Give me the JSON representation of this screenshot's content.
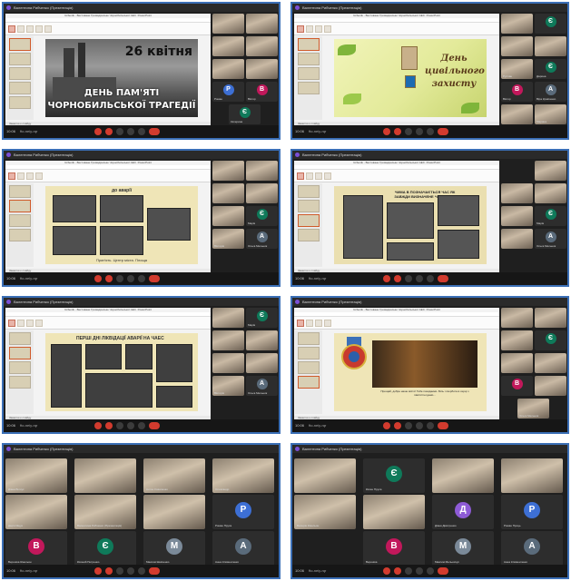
{
  "meet": {
    "presenter": "Валентина Рибченко (Презентація)",
    "time": "10:06",
    "meeting_code": "fto-neiy-rqr",
    "colors": {
      "frame": "#3b6fb6",
      "end_call": "#d23b2e"
    }
  },
  "ppt": {
    "window_title": "Ucbenik - Вестоване Громадянське Чорнобильської АЕС. PowerPoint",
    "status": "Заметки к слайду"
  },
  "slides": {
    "s1": {
      "date": "26 квітня",
      "line1": "ДЕНЬ ПАМ'ЯТІ",
      "line2": "ЧОРНОБИЛЬСЬКОЇ ТРАГЕДІЇ"
    },
    "s2": {
      "line1": "День",
      "line2": "цивільного",
      "line3": "захисту"
    },
    "s3": {
      "header": "до аварії",
      "label": "Прип'ять. Центр міста. Площа"
    },
    "s4": {
      "question": "ЧИМА В ПОЗНАЧАЄТЬСЯ ЧАС ЯК ЗАВЖДИ ВИЗНАЧЕНЕ ЧАС РОКУ?"
    },
    "s5": {
      "header": "ПЕРШІ ДНІ ЛІКВІДАЦІЇ АВАРІЇ НА ЧАЕС"
    },
    "s6": {
      "poem": "Прощай, добре наше місто! Тебе покидаємо. Біль і скорбота в серці з пам'яттю ідемо..."
    }
  },
  "participants": {
    "p1": [
      "Наталія",
      "Степан",
      "Володимир",
      "Сергій",
      "Роман",
      "Віктор",
      "Вікторія",
      "Катерина",
      "Ольга Мельник"
    ],
    "p2": [
      "Валентина",
      "Марія",
      "Руслан",
      "Сергій",
      "Дарина",
      "Віктор",
      "Богдан",
      "Віра Кравченко",
      "Марина"
    ],
    "gallery": [
      "Діана Білоус",
      "Антон Коваленко",
      "Олександр",
      "Артем Каник",
      "Д",
      "Валентина Рибченко (Презентація)",
      "Дар'я Ящук",
      "Роман Пруса",
      "Вероніка Ємельян",
      "Євгеній Петренко",
      "Максим Шевченко",
      "Анна Климентенко"
    ],
    "gallery2": [
      "Валентина",
      "Євген Пруса",
      "Ірина",
      "Роман",
      "Катерина",
      "Валерія Ємельян",
      "Д",
      "Діана Дмитренко",
      "Роман Проць",
      "Вероніка",
      "Максим Мельничук",
      "Анна Климентенко"
    ],
    "initials": {
      "V": "В",
      "E": "Є",
      "M": "М",
      "A": "А",
      "P": "Р",
      "D": "Д"
    }
  }
}
